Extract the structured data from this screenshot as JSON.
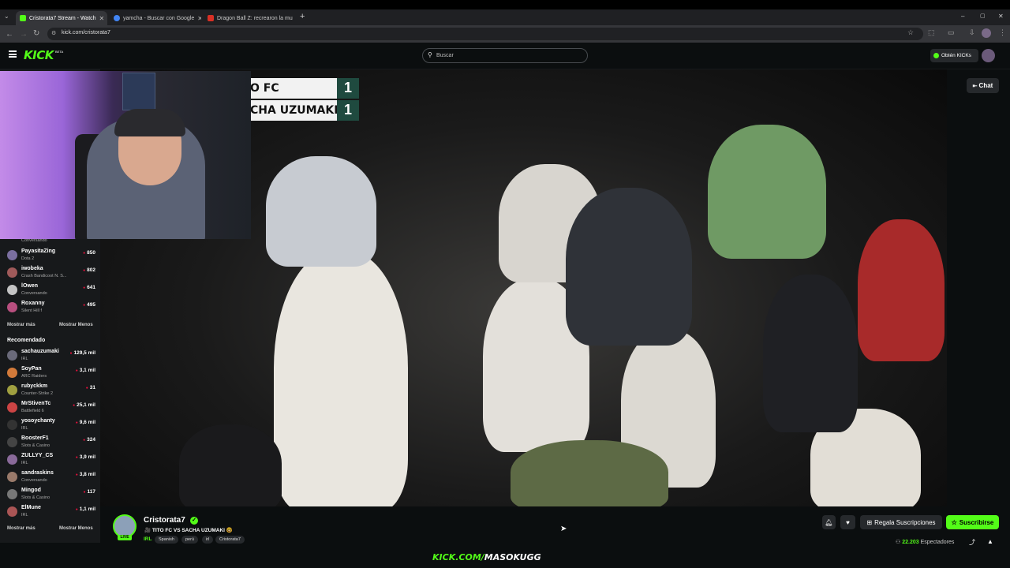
{
  "browser": {
    "tabs": [
      {
        "title": "Cristorata7 Stream - Watch",
        "color": "#53fc18"
      },
      {
        "title": "yamcha - Buscar con Google",
        "color": "#4285f4"
      },
      {
        "title": "Dragon Ball Z: recrearon la mu",
        "color": "#d93025"
      }
    ],
    "url": "kick.com/cristorata7"
  },
  "header": {
    "logo": "KICK",
    "beta": "BETA",
    "search_placeholder": "Buscar",
    "kicks_button": "Obtén KICKs"
  },
  "sidebar": {
    "following": [
      {
        "name": "",
        "category": "Conversando",
        "viewers": ""
      },
      {
        "name": "PayasitaZing",
        "category": "Dota 2",
        "viewers": "850",
        "color": "#7b6fa0"
      },
      {
        "name": "iwobeka",
        "category": "Crash Bandicoot N. S...",
        "viewers": "802",
        "color": "#a05a5a"
      },
      {
        "name": "lOwen",
        "category": "Conversando",
        "viewers": "641",
        "color": "#c4c4c4"
      },
      {
        "name": "Roxanny",
        "category": "Silent Hill f",
        "viewers": "495",
        "color": "#b84f7f"
      }
    ],
    "show_more": "Mostrar más",
    "show_less": "Mostrar Menos",
    "recommended_title": "Recomendado",
    "recommended": [
      {
        "name": "sachauzumaki",
        "category": "IRL",
        "viewers": "129,5 mil",
        "color": "#6a6a7a"
      },
      {
        "name": "SoyPan",
        "category": "ARC Raiders",
        "viewers": "3,1 mil",
        "color": "#d27a3a"
      },
      {
        "name": "rubyckkm",
        "category": "Counter-Strike 2",
        "viewers": "31",
        "color": "#a0a040"
      },
      {
        "name": "MrStivenTc",
        "category": "Battlefield 6",
        "viewers": "25,1 mil",
        "color": "#c44"
      },
      {
        "name": "yosoychanty",
        "category": "IRL",
        "viewers": "9,6 mil",
        "color": "#333"
      },
      {
        "name": "BoosterF1",
        "category": "Slots & Casino",
        "viewers": "324",
        "color": "#444"
      },
      {
        "name": "ZULLYY_CS",
        "category": "IRL",
        "viewers": "3,9 mil",
        "color": "#8a6a9a"
      },
      {
        "name": "sandraskins",
        "category": "Conversando",
        "viewers": "3,8 mil",
        "color": "#9a7a6a"
      },
      {
        "name": "Mingod",
        "category": "Slots & Casino",
        "viewers": "117",
        "color": "#777"
      },
      {
        "name": "ElMune",
        "category": "IRL",
        "viewers": "1,1 mil",
        "color": "#a55"
      }
    ]
  },
  "video": {
    "score_team1": "O FC",
    "score_team2": "CHA UZUMAKI",
    "score1": "1",
    "score2": "1",
    "chat_button": "Chat"
  },
  "channel": {
    "name": "Cristorata7",
    "live_badge": "LIVE",
    "stream_title": "🎥 TITO FC VS SACHA UZUMAKI 🤓",
    "category": "IRL",
    "tags": [
      "Spanish",
      "perú",
      "irl",
      "Cristorata7"
    ],
    "gift_button": "Regala Suscripciones",
    "subscribe_button": "Suscribirse",
    "viewers_count": "22.203",
    "viewers_label": "Espectadores"
  },
  "overlay_text": {
    "part1": "KICK.COM/",
    "part2": "MASOKUGG"
  }
}
